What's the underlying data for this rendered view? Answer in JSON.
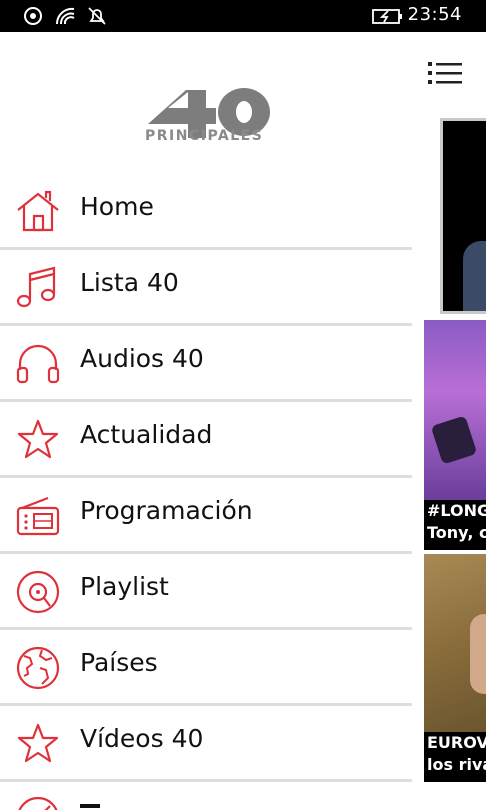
{
  "status_bar": {
    "time": "23:54",
    "icons": [
      "location-icon",
      "wifi-icon",
      "bell-muted-icon",
      "battery-charging-icon"
    ]
  },
  "app": {
    "logo_number": "40",
    "logo_text": "PRINCIPALES",
    "accent_color": "#e0313b"
  },
  "menu": {
    "items": [
      {
        "label": "Home",
        "icon": "home-icon"
      },
      {
        "label": "Lista 40",
        "icon": "music-note-icon"
      },
      {
        "label": "Audios 40",
        "icon": "headphones-icon"
      },
      {
        "label": "Actualidad",
        "icon": "star-icon"
      },
      {
        "label": "Programación",
        "icon": "radio-icon"
      },
      {
        "label": "Playlist",
        "icon": "vinyl-icon"
      },
      {
        "label": "Países",
        "icon": "globe-icon"
      },
      {
        "label": "Vídeos 40",
        "icon": "star-icon"
      }
    ]
  },
  "content": {
    "card1_caption_line1": "#LONG",
    "card1_caption_line2": "Tony, c",
    "card2_caption_line1": "EUROV",
    "card2_caption_line2": "los riva"
  }
}
